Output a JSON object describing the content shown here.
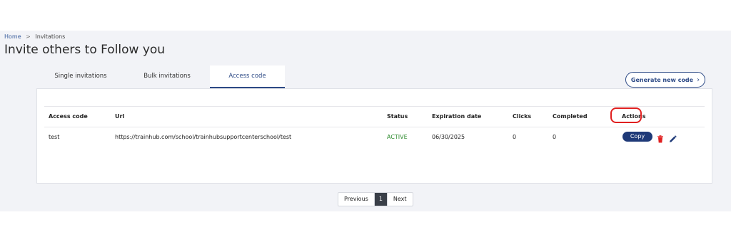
{
  "breadcrumb": {
    "home": "Home",
    "separator": ">",
    "current": "Invitations"
  },
  "page_title": "Invite others to Follow you",
  "tabs": [
    {
      "label": "Single invitations",
      "active": false
    },
    {
      "label": "Bulk invitations",
      "active": false
    },
    {
      "label": "Access code",
      "active": true
    }
  ],
  "generate_button": {
    "label": "Generate new code",
    "icon": "chevron-right-icon"
  },
  "table": {
    "headers": {
      "access_code": "Access code",
      "url": "Url",
      "status": "Status",
      "expiration_date": "Expiration date",
      "clicks": "Clicks",
      "completed": "Completed",
      "actions": "Actions"
    },
    "rows": [
      {
        "access_code": "test",
        "url": "https://trainhub.com/school/trainhubsupportcenterschool/test",
        "status": "ACTIVE",
        "expiration_date": "06/30/2025",
        "clicks": "0",
        "completed": "0",
        "copy_label": "Copy"
      }
    ]
  },
  "pagination": {
    "previous": "Previous",
    "current_page": "1",
    "next": "Next"
  },
  "colors": {
    "brand": "#1f3a78",
    "status_active": "#2e8b2e",
    "delete": "#e02020",
    "highlight": "#e02020"
  },
  "icons": {
    "delete": "trash-icon",
    "edit": "pencil-icon"
  }
}
